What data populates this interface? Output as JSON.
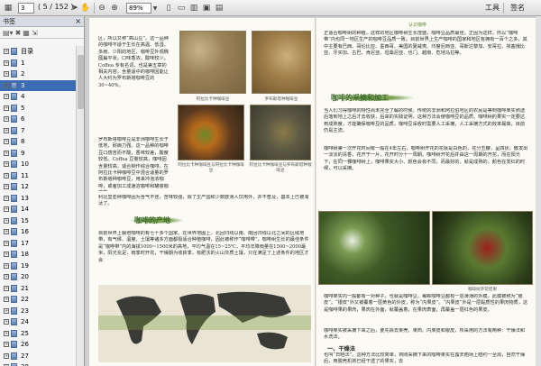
{
  "toolbar": {
    "page_current": "3",
    "page_total": "( 5 / 152 )",
    "zoom": "89%",
    "tools_label": "工具",
    "sign_label": "签名"
  },
  "sidebar": {
    "title": "书签",
    "close": "×",
    "items": [
      {
        "label": "目录"
      },
      {
        "label": "1"
      },
      {
        "label": "2"
      },
      {
        "label": "3"
      },
      {
        "label": "4"
      },
      {
        "label": "5"
      },
      {
        "label": "6"
      },
      {
        "label": "7"
      },
      {
        "label": "8"
      },
      {
        "label": "9"
      },
      {
        "label": "10"
      },
      {
        "label": "11"
      },
      {
        "label": "12"
      },
      {
        "label": "13"
      },
      {
        "label": "14"
      },
      {
        "label": "15"
      },
      {
        "label": "16"
      },
      {
        "label": "17"
      },
      {
        "label": "18"
      },
      {
        "label": "19"
      },
      {
        "label": "20"
      },
      {
        "label": "21"
      },
      {
        "label": "22"
      },
      {
        "label": "23"
      },
      {
        "label": "24"
      },
      {
        "label": "25"
      },
      {
        "label": "26"
      },
      {
        "label": "27"
      },
      {
        "label": "28"
      }
    ]
  },
  "page_left": {
    "col_text": "区，所以又称“高山豆”。这一品种的咖啡不适于生长在高温、低湿、多雨、少阳的地区，咖啡豆外观椭圆扁平状，口味香浓，酸味较少。Coffea 专有名词，也是第五章的相关内容，含量适中的咖啡因能让人大约为罗布斯塔咖啡豆的 30~40%。",
    "col_text2": "罗布斯塔咖啡豆是非洲咖啡生长于低地，耐病力强。这一品种的咖啡豆口感苦而不酸，香味较差，酸度较低。Coffea 豆量较高，咖啡因含量较高，适合制作综合咖啡。在阿拉比卡种咖啡豆中混合适量的罗布斯塔种咖啡豆，用来冲泡浓咖啡，或者加工成速溶咖啡和罐装咖啡等。",
    "col_text3": "利比里亚种咖啡因为含气不佳，苦味较强，除了生产国和少数欧洲人饮用外，并不普及，基本上已被淘汰了。",
    "cap1": "阿拉比卡种咖啡豆",
    "cap2": "罗布斯塔种咖啡豆",
    "cap3": "阿拉比卡种咖啡豆与阿拉比卡种咖啡豆",
    "cap4": "阿拉比卡种咖啡豆与罗布斯塔种咖啡豆",
    "heading": "咖啡的产地",
    "body": "目前世界上栽培咖啡的有七十多个国家。在世界地图上，北回归线以南、南回归线以北之间的区域地带，有气候、温度、土壤等诸多方面都极适合种植咖啡，因此被称作“咖啡带”。咖啡树生长的最佳条件是“咖啡带”内的海拔1000~1500米的高地，平均气温在15~25℃，平均年降雨量在1500~2000毫米，阳光充足，雨季时开花，干燥期为收获季，有肥沃的火山灰质土壤，只在满足了上述条件的地区才会"
  },
  "page_right": {
    "runhead": "认识咖啡",
    "top_text": "正适合咖啡树的种植，这样的地区咖啡树生长茂盛，咖啡豆品质最佳。正因为这样，所以“咖啡带”内也同一地区生产的咖啡豆品质一致。目前世界上生产咖啡的国家和地区有拥有一百个之多，其中主要有巴西、哥伦比亚、墨西哥、美国的夏威夷、印度尼西亚、哥斯达黎加、安哥拉、埃塞俄比亚、牙买加、古巴、肯尼亚、坦桑尼亚、也门、越南、危地马拉等。",
    "heading": "咖啡的采摘和加工",
    "body": "当人们习得咖啡的特性尚未完全了解的时候，传统的非洲和阿拉伯地区的农民是等到咖啡果实熟透后落到地上之后才去收获，后来的实践证明，这种方法会使咖啡豆的品质、咖啡树的果实一定要达到成熟度，才能确保咖啡豆的品质。咖啡豆采收时需要人工采摘，人工采摘方式的效率最高，目前仍是主流。",
    "body2": "咖啡树第一次开花时间有一般在4年左右，咖啡树开花的花就是白色的，花分五瓣，呈四状，散发出一淡淡的清香，花开于一片，花开时分十一周期。咖啡树开花后并由这一周期的开花，而在阳光下，在同一棵咖啡树上，咖啡果实大小、颜色会有不同，而最好的，就是成熟的，颜色在发红的时候，可以采摘。",
    "cap": "咖啡树开花结果",
    "body3": "咖啡果实内一般都有一对种子，也就是咖啡豆。每颗咖啡豆都有一层薄薄的外膜，此膜被称为“银皮”。“银皮”外又被覆着一层黄色的外皮，称为“内果皮”。“内果皮”外是一层黏质性的果肉物质，这是咖啡果的果肉，果肉在外面，就覆盖着，在果肉表面，再覆盖一层红色的果皮。",
    "body4": "咖啡果实被采摘下来之后，要先除去果壳、果肉、内果皮和银皮，所采用的方法有两种：干燥法和水洗法。",
    "sub": "一、干燥法",
    "body5": "也叫“日晒法”。这种方法比较简单，将刚采摘下来的咖啡果实在露天晒场上晒约一至周，自然干燥后，用脱壳机将已经干透了的果实，去"
  },
  "colors": {
    "heading_green": "#3d6a2a",
    "selection_blue": "#3c6cb4"
  }
}
